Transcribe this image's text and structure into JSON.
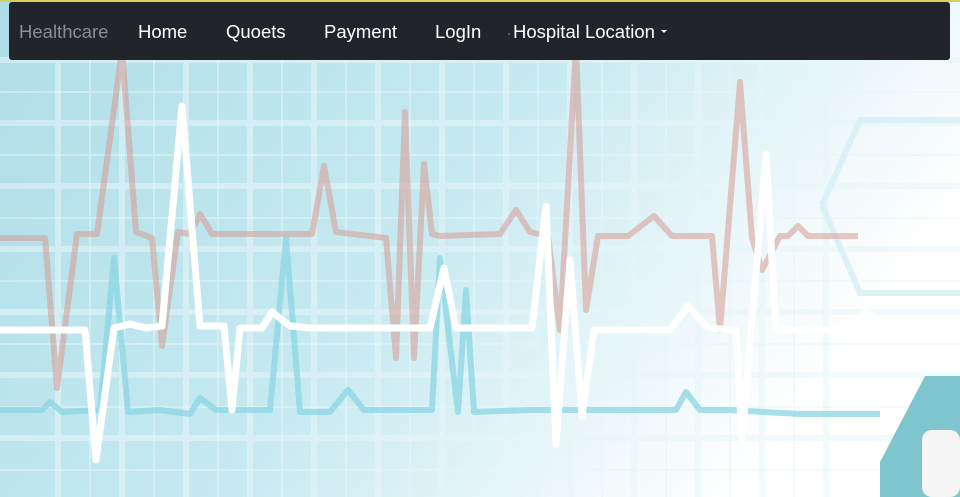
{
  "navbar": {
    "brand": "Healthcare",
    "items": [
      {
        "label": "Home"
      },
      {
        "label": "Quoets"
      },
      {
        "label": "Payment"
      },
      {
        "label": "LogIn"
      }
    ],
    "dropdown": {
      "label": "Hospital Location"
    }
  },
  "colors": {
    "navbar_bg": "#212529",
    "brand_text": "#8a8d91",
    "nav_text": "#ffffff",
    "hero_bg": "#bfe3ec",
    "top_border": "#d8cf63"
  },
  "icons": {
    "dropdown": "caret-down-icon"
  }
}
